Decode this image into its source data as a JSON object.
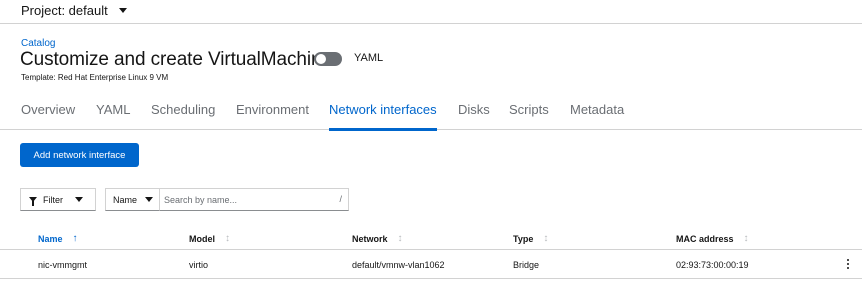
{
  "project": {
    "label": "Project: default"
  },
  "breadcrumb": "Catalog",
  "title": "Customize and create VirtualMachine",
  "yaml_switch": {
    "label": "YAML",
    "on": false
  },
  "template_line": "Template: Red Hat Enterprise Linux 9 VM",
  "tabs": [
    {
      "label": "Overview",
      "active": false
    },
    {
      "label": "YAML",
      "active": false
    },
    {
      "label": "Scheduling",
      "active": false
    },
    {
      "label": "Environment",
      "active": false
    },
    {
      "label": "Network interfaces",
      "active": true
    },
    {
      "label": "Disks",
      "active": false
    },
    {
      "label": "Scripts",
      "active": false
    },
    {
      "label": "Metadata",
      "active": false
    }
  ],
  "add_button": "Add network interface",
  "toolbar": {
    "filter_label": "Filter",
    "name_select": "Name",
    "search_placeholder": "Search by name...",
    "search_value": "",
    "shortcut_hint": "/"
  },
  "table": {
    "columns": [
      "Name",
      "Model",
      "Network",
      "Type",
      "MAC address"
    ],
    "rows": [
      {
        "name": "nic-vmmgmt",
        "model": "virtio",
        "network": "default/vmnw-vlan1062",
        "type": "Bridge",
        "mac": "02:93:73:00:00:19"
      }
    ]
  },
  "colors": {
    "accent": "#0066cc",
    "text": "#151515",
    "muted": "#6a6e73",
    "border": "#d2d2d2"
  }
}
